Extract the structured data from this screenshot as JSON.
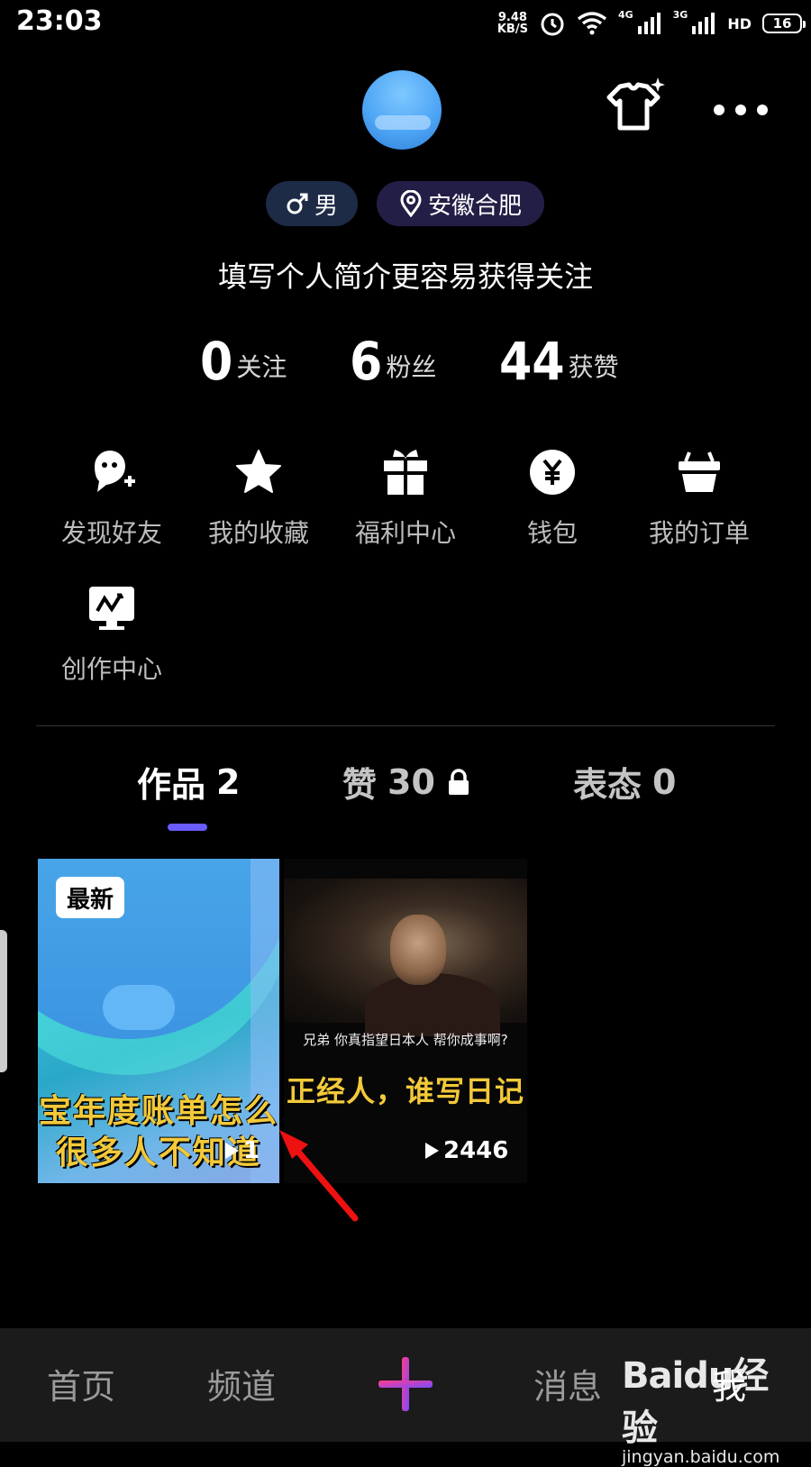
{
  "status_bar": {
    "time": "23:03",
    "speed_value": "9.48",
    "speed_unit": "KB/S",
    "signal1": "4G",
    "signal2": "3G",
    "hd": "HD",
    "battery": "16"
  },
  "profile": {
    "gender": "男",
    "location": "安徽合肥",
    "bio_prompt": "填写个人简介更容易获得关注",
    "stats": [
      {
        "value": "0",
        "label": "关注"
      },
      {
        "value": "6",
        "label": "粉丝"
      },
      {
        "value": "44",
        "label": "获赞"
      }
    ]
  },
  "menu": [
    {
      "label": "发现好友",
      "icon": "add-friend-icon"
    },
    {
      "label": "我的收藏",
      "icon": "star-icon"
    },
    {
      "label": "福利中心",
      "icon": "gift-icon"
    },
    {
      "label": "钱包",
      "icon": "yuan-icon"
    },
    {
      "label": "我的订单",
      "icon": "basket-icon"
    },
    {
      "label": "创作中心",
      "icon": "monitor-icon"
    }
  ],
  "tabs": [
    {
      "label": "作品",
      "count": "2",
      "active": true
    },
    {
      "label": "赞",
      "count": "30",
      "locked": true
    },
    {
      "label": "表态",
      "count": "0"
    }
  ],
  "works": [
    {
      "badge": "最新",
      "caption_line1": "宝年度账单怎么",
      "caption_line2": "很多人不知道",
      "plays": "1"
    },
    {
      "subtitle_small": "兄弟 你真指望日本人 帮你成事啊?",
      "subtitle_big": "正经人，谁写日记",
      "plays": "2446"
    }
  ],
  "bottom_nav": {
    "home": "首页",
    "channel": "频道",
    "messages": "消息",
    "me": "我"
  },
  "watermark": {
    "brand": "Baidu经验",
    "url": "jingyan.baidu.com"
  },
  "colors": {
    "accent": "#6a5cff",
    "caption_yellow": "#f2c93a",
    "plus_gradient_start": "#ff3b8d",
    "plus_gradient_end": "#7a4cff"
  }
}
